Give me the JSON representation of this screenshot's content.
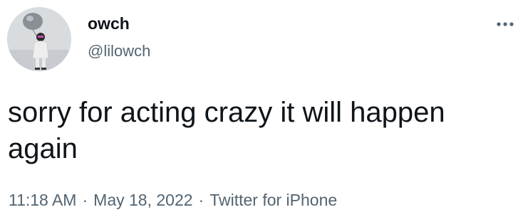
{
  "author": {
    "display_name": "owch",
    "handle": "@lilowch"
  },
  "icons": {
    "more": "more-horizontal-icon",
    "avatar": "profile-photo"
  },
  "tweet": {
    "text": "sorry for acting crazy it will happen again"
  },
  "meta": {
    "time": "11:18 AM",
    "separator": "·",
    "date": "May 18, 2022",
    "source": "Twitter for iPhone"
  },
  "colors": {
    "primary_text": "#0f1419",
    "secondary_text": "#536471",
    "background": "#ffffff"
  }
}
